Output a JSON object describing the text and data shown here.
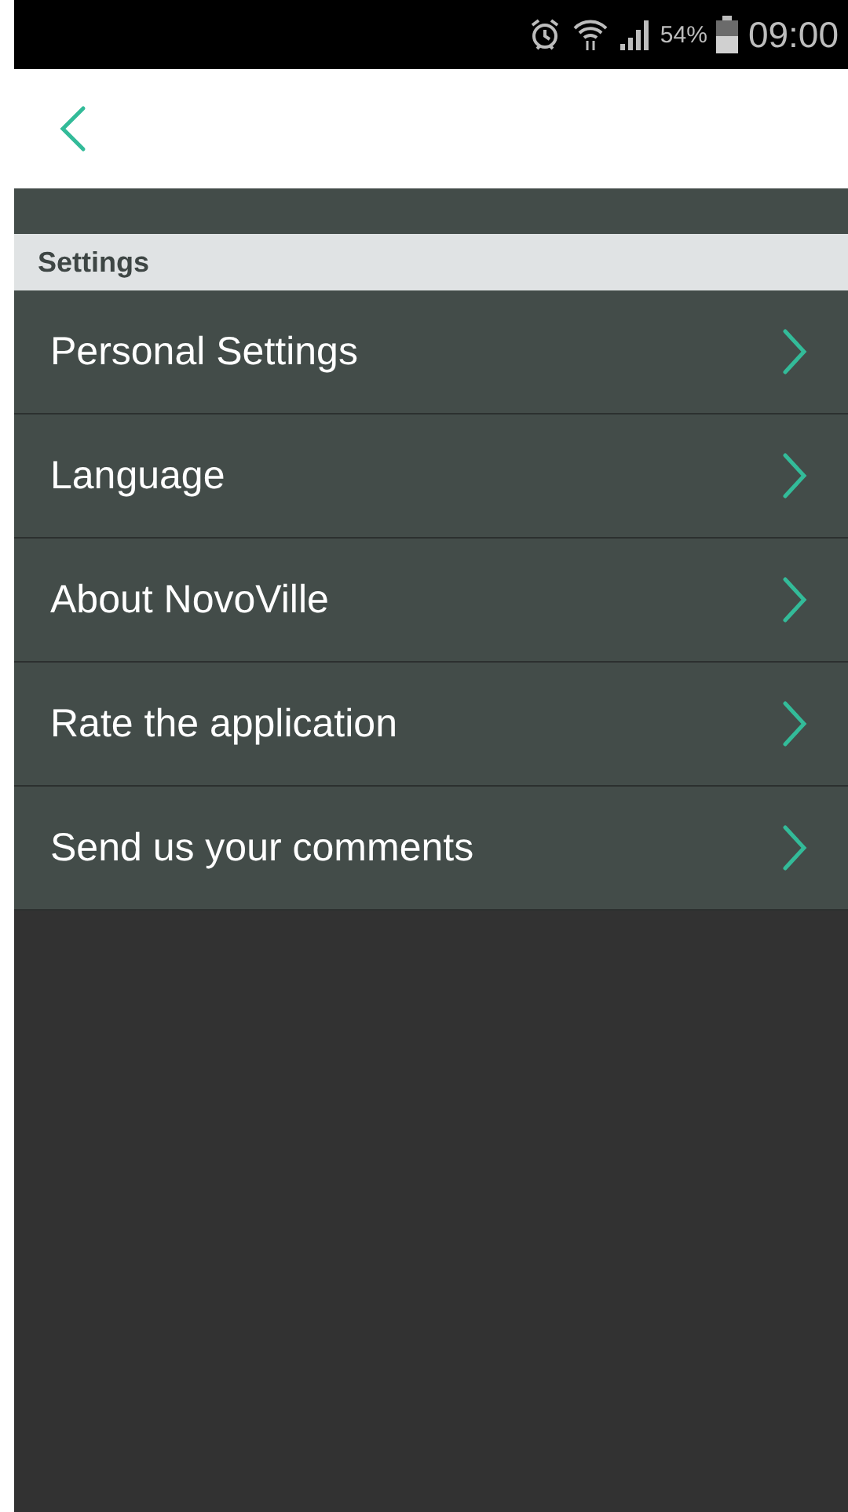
{
  "status_bar": {
    "battery_text": "54%",
    "time": "09:00"
  },
  "section": {
    "title": "Settings"
  },
  "items": [
    {
      "label": "Personal Settings"
    },
    {
      "label": "Language"
    },
    {
      "label": "About NovoVille"
    },
    {
      "label": "Rate the application"
    },
    {
      "label": "Send us your comments"
    }
  ]
}
